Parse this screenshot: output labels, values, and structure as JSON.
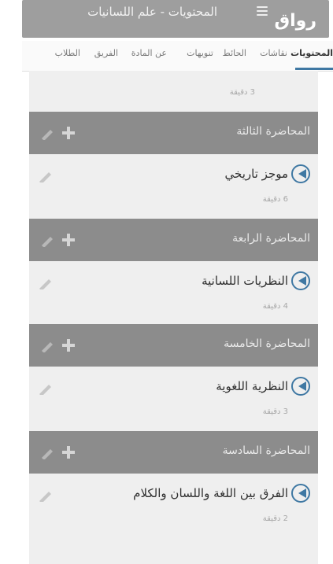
{
  "header": {
    "title": "المحتويات - علم اللسانيات",
    "logo": "رواق"
  },
  "tabs": [
    {
      "label": "المحتويات",
      "active": true
    },
    {
      "label": "نقاشات",
      "active": false
    },
    {
      "label": "الحائط",
      "active": false
    },
    {
      "label": "تنويهات",
      "active": false
    },
    {
      "label": "عن المادة",
      "active": false
    },
    {
      "label": "الفريق",
      "active": false
    },
    {
      "label": "الطلاب",
      "active": false
    }
  ],
  "first_lesson": {
    "meta": "3 دقيقة"
  },
  "sections": [
    {
      "title": "المحاضرة الثالثة",
      "lesson": {
        "title": "موجز تاريخي",
        "meta": "6 دقيقة"
      }
    },
    {
      "title": "المحاضرة الرابعة",
      "lesson": {
        "title": "النظريات اللسانية",
        "meta": "4 دقيقة"
      }
    },
    {
      "title": "المحاضرة الخامسة",
      "lesson": {
        "title": "النظرية اللغوية",
        "meta": "3 دقيقة"
      }
    },
    {
      "title": "المحاضرة السادسة",
      "lesson": {
        "title": "الفرق بين اللغة واللسان والكلام",
        "meta": "2 دقيقة"
      }
    }
  ],
  "colors": {
    "accent": "#3f78a3",
    "header_bg": "#9e9e9e",
    "section_bg": "#8c8c8c",
    "content_bg": "#efefef"
  }
}
